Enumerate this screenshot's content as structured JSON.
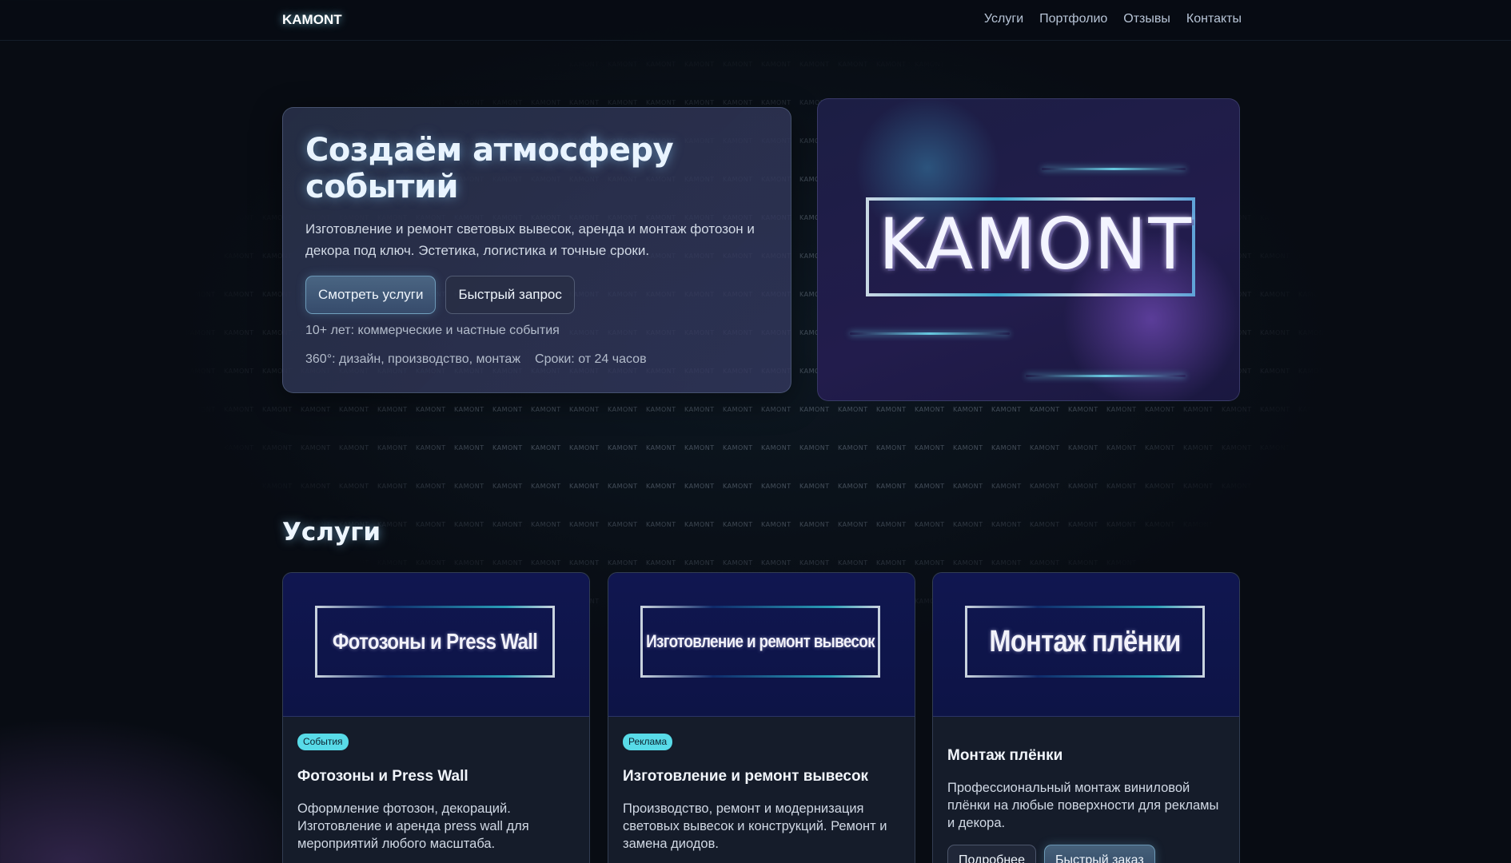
{
  "header": {
    "brand": "KAMONT",
    "nav": [
      "Услуги",
      "Портфолио",
      "Отзывы",
      "Контакты"
    ]
  },
  "watermark": {
    "text": "KAMONT"
  },
  "hero": {
    "title": "Создаём атмосферу событий",
    "description": "Изготовление и ремонт световых вывесок, аренда и монтаж фотозон и декора под ключ. Эстетика, логистика и точные сроки.",
    "primary_button": "Смотреть услуги",
    "secondary_button": "Быстрый запрос",
    "meta_experience": "10+ лет: коммерческие и частные события",
    "meta_scope": "360°: дизайн, производство, монтаж",
    "meta_terms": "Сроки: от 24 часов",
    "banner_logo": "KAMONT"
  },
  "services": {
    "title": "Услуги",
    "cards": [
      {
        "image_text": "Фотозоны и Press Wall",
        "tag": "События",
        "title": "Фотозоны и Press Wall",
        "text": "Оформление фотозон, декораций. Изготовление и аренда press wall для мероприятий любого масштаба."
      },
      {
        "image_text": "Изготовление и ремонт вывесок",
        "tag": "Реклама",
        "title": "Изготовление и ремонт вывесок",
        "text": "Производство, ремонт и модернизация световых вывесок и конструкций. Ремонт и замена диодов."
      },
      {
        "image_text": "Монтаж плёнки",
        "title": "Монтаж плёнки",
        "text": "Профессиональный монтаж виниловой плёнки на любые поверхности для рекламы и декора.",
        "details_button": "Подробнее",
        "order_button": "Быстрый заказ"
      }
    ]
  },
  "colors": {
    "background": "#080c13",
    "accent": "#58dbe8",
    "card": "#151c2a",
    "banner": "#1c1e44"
  }
}
